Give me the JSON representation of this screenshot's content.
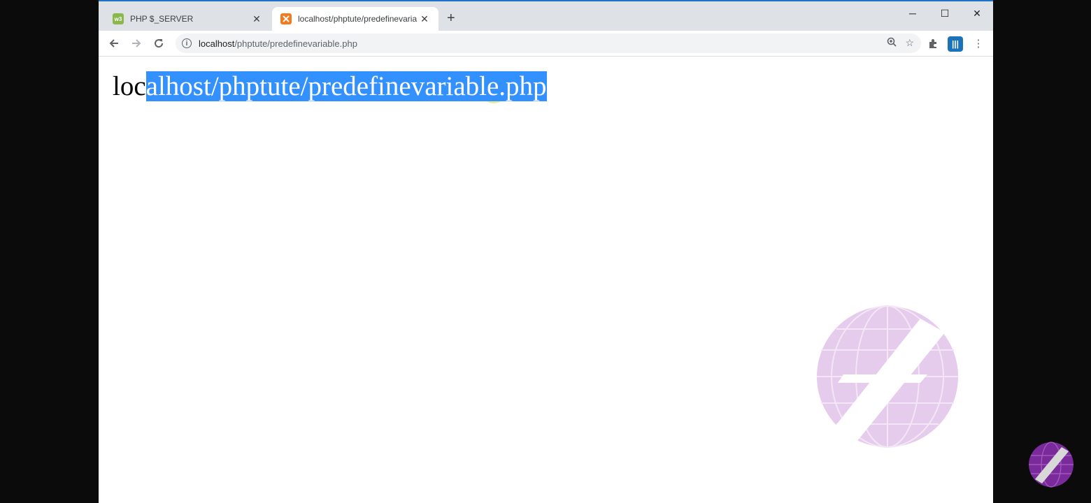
{
  "browser": {
    "tabs": [
      {
        "title": "PHP $_SERVER",
        "favicon": "w3schools-icon",
        "favicon_text": "w3"
      },
      {
        "title": "localhost/phptute/predefinevaria",
        "favicon": "xampp-icon",
        "active": true
      }
    ],
    "address": {
      "host": "localhost",
      "path": "/phptute/predefinevariable.php"
    }
  },
  "page": {
    "text_unselected": "loc",
    "text_selected": "alhost/phptute/predefinevariable.php"
  },
  "colors": {
    "selection": "#3390ff",
    "tabstrip": "#dee1e6",
    "watermark": "#e3c6ea",
    "corner_logo": "#7a2a9a"
  }
}
